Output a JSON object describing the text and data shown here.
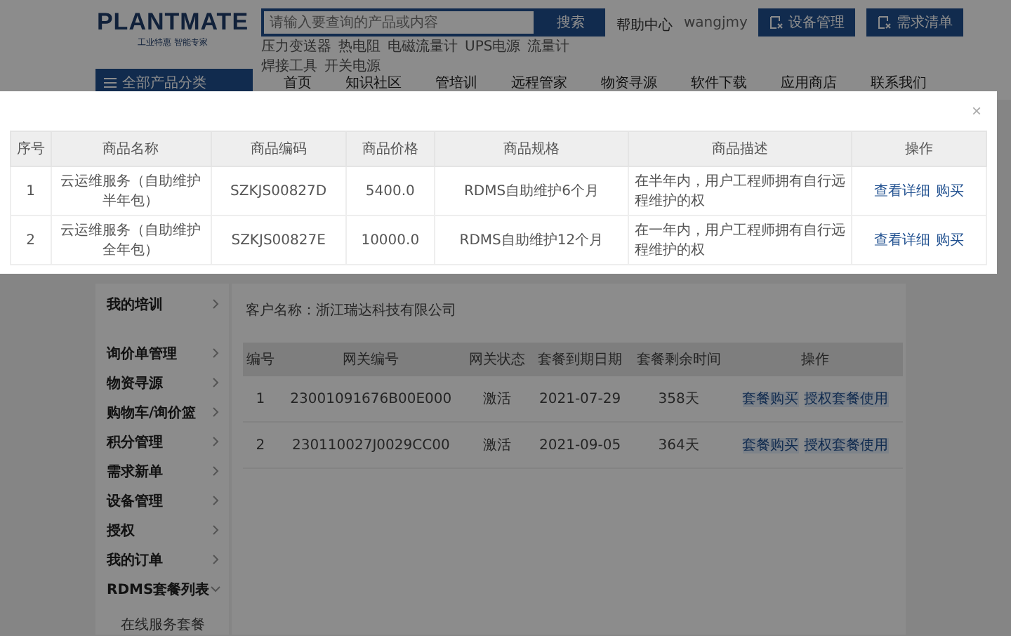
{
  "header": {
    "logo": "PLANTMATE",
    "tagline": "工业特惠 智能专家",
    "search": {
      "placeholder": "请输入要查询的产品或内容",
      "button": "搜索"
    },
    "hot_links": [
      "压力变送器",
      "热电阻",
      "电磁流量计",
      "UPS电源",
      "流量计",
      "焊接工具",
      "开关电源"
    ],
    "help": "帮助中心",
    "user": "wangjmy",
    "buttons": [
      "设备管理",
      "需求清单"
    ]
  },
  "nav": {
    "category_menu": "全部产品分类",
    "items": [
      "首页",
      "知识社区",
      "管培训",
      "远程管家",
      "物资寻源",
      "软件下载",
      "应用商店",
      "联系我们"
    ]
  },
  "sidebar": {
    "items": [
      {
        "label": "我的培训",
        "expanded": false
      },
      {
        "label": "询价单管理",
        "expanded": false
      },
      {
        "label": "物资寻源",
        "expanded": false
      },
      {
        "label": "购物车/询价篮",
        "expanded": false
      },
      {
        "label": "积分管理",
        "expanded": false
      },
      {
        "label": "需求新单",
        "expanded": false
      },
      {
        "label": "设备管理",
        "expanded": false
      },
      {
        "label": "授权",
        "expanded": false
      },
      {
        "label": "我的订单",
        "expanded": false
      },
      {
        "label": "RDMS套餐列表",
        "expanded": true,
        "children": [
          {
            "label": "在线服务套餐"
          }
        ]
      }
    ]
  },
  "content": {
    "customer": "客户名称：浙江瑞达科技有限公司",
    "table": {
      "columns": [
        "编号",
        "网关编号",
        "网关状态",
        "套餐到期日期",
        "套餐剩余时间",
        "操作"
      ],
      "rows": [
        {
          "cells": [
            "1",
            "23001091676B00E000",
            "激活",
            "2021-07-29",
            "358天"
          ],
          "actions": [
            "套餐购买",
            "授权套餐使用"
          ]
        },
        {
          "cells": [
            "2",
            "230110027J0029CC00",
            "激活",
            "2021-09-05",
            "364天"
          ],
          "actions": [
            "套餐购买",
            "授权套餐使用"
          ]
        }
      ]
    }
  },
  "modal": {
    "close": "×",
    "table": {
      "columns": [
        "序号",
        "商品名称",
        "商品编码",
        "商品价格",
        "商品规格",
        "商品描述",
        "操作"
      ],
      "rows": [
        {
          "cells": [
            "1",
            "云运维服务（自助维护半年包）",
            "SZKJS00827D",
            "5400.0",
            "RDMS自助维护6个月",
            "在半年内，用户工程师拥有自行远程维护的权"
          ],
          "actions": [
            "查看详细",
            "购买"
          ]
        },
        {
          "cells": [
            "2",
            "云运维服务（自助维护全年包）",
            "SZKJS00827E",
            "10000.0",
            "RDMS自助维护12个月",
            "在一年内，用户工程师拥有自行远程维护的权"
          ],
          "actions": [
            "查看详细",
            "购买"
          ]
        }
      ]
    }
  }
}
